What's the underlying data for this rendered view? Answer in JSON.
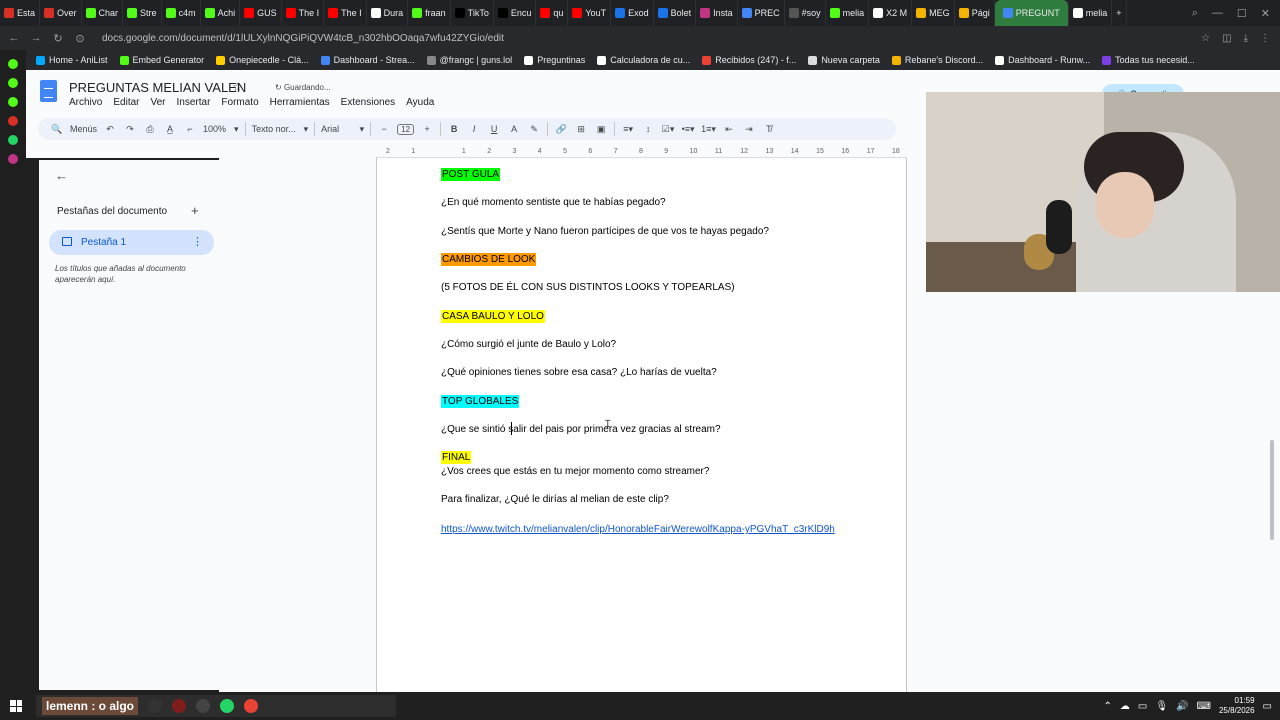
{
  "browser": {
    "tabs": [
      {
        "label": "Esta",
        "color": "#d93025"
      },
      {
        "label": "Over",
        "color": "#d93025"
      },
      {
        "label": "Char",
        "color": "#53fc18"
      },
      {
        "label": "Stre",
        "color": "#53fc18"
      },
      {
        "label": "c4m",
        "color": "#53fc18"
      },
      {
        "label": "Achi",
        "color": "#53fc18"
      },
      {
        "label": "GUS",
        "color": "#ff0000"
      },
      {
        "label": "The I",
        "color": "#ff0000"
      },
      {
        "label": "The I",
        "color": "#ff0000"
      },
      {
        "label": "Dura",
        "color": "#ffffff"
      },
      {
        "label": "fraan",
        "color": "#53fc18"
      },
      {
        "label": "TikTo",
        "color": "#000000"
      },
      {
        "label": "Encu",
        "color": "#000000"
      },
      {
        "label": "qu",
        "color": "#ff0000"
      },
      {
        "label": "YouT",
        "color": "#ff0000"
      },
      {
        "label": "Exod",
        "color": "#1a73e8"
      },
      {
        "label": "Bolet",
        "color": "#1a73e8"
      },
      {
        "label": "Insta",
        "color": "#c13584"
      },
      {
        "label": "PREC",
        "color": "#4285f4"
      },
      {
        "label": "#soy",
        "color": "#555555"
      },
      {
        "label": "melia",
        "color": "#53fc18"
      },
      {
        "label": "X2 M",
        "color": "#ffffff"
      },
      {
        "label": "MEG",
        "color": "#f4b400"
      },
      {
        "label": "Pági",
        "color": "#f4b400"
      },
      {
        "label": "PREGUNT",
        "color": "#4285f4",
        "active": true
      },
      {
        "label": "melia",
        "color": "#ffffff"
      }
    ],
    "new_tab": "+",
    "url": "docs.google.com/document/d/1lULXylnNQGiPiQVW4tcB_n302hbOOaqa7wfu42ZYGio/edit",
    "bookmarks": [
      {
        "label": "Home - AniList",
        "color": "#02a9ff"
      },
      {
        "label": "Embed Generator",
        "color": "#53fc18"
      },
      {
        "label": "Onepiecedle - Clá...",
        "color": "#ffcc00"
      },
      {
        "label": "Dashboard - Strea...",
        "color": "#4285f4"
      },
      {
        "label": "@frangc | guns.lol",
        "color": "#888888"
      },
      {
        "label": "Preguntinas",
        "color": "#ffffff"
      },
      {
        "label": "Calculadora de cu...",
        "color": "#ffffff"
      },
      {
        "label": "Recibidos (247) - f...",
        "color": "#ea4335"
      },
      {
        "label": "Nueva carpeta",
        "color": "#dadce0"
      },
      {
        "label": "Rebane's Discord...",
        "color": "#f4b400"
      },
      {
        "label": "Dashboard - Runw...",
        "color": "#ffffff"
      },
      {
        "label": "Todas tus necesid...",
        "color": "#7b3fe4"
      }
    ]
  },
  "docs": {
    "title": "PREGUNTAS MELIAN VALEN",
    "saving_status": "Guardando...",
    "menu": [
      "Archivo",
      "Editar",
      "Ver",
      "Insertar",
      "Formato",
      "Herramientas",
      "Extensiones",
      "Ayuda"
    ],
    "share_label": "Compartir",
    "toolbar": {
      "menus_label": "Menús",
      "zoom": "100%",
      "style": "Texto nor...",
      "font": "Arial",
      "font_size": "12"
    },
    "outline": {
      "title": "Pestañas del documento",
      "tab_name": "Pestaña 1",
      "hint": "Los títulos que añadas al documento aparecerán aquí."
    },
    "ruler_marks": [
      "2",
      "1",
      "",
      "1",
      "2",
      "3",
      "4",
      "5",
      "6",
      "7",
      "8",
      "9",
      "10",
      "11",
      "12",
      "13",
      "14",
      "15",
      "16",
      "17",
      "18"
    ]
  },
  "document": {
    "lines": [
      {
        "text": "POST GULA",
        "highlight": "#00ff00"
      },
      {
        "text": "¿En qué momento sentiste que te habías pegado?"
      },
      {
        "text": "¿Sentís que Morte y Nano fueron partícipes de que vos te hayas pegado?"
      },
      {
        "text": "CAMBIOS DE LOOK",
        "highlight": "#ff9900"
      },
      {
        "text": "(5 FOTOS DE ÉL CON SUS DISTINTOS LOOKS Y TOPEARLAS)"
      },
      {
        "text": "CASA BAULO Y LOLO",
        "highlight": "#ffff00"
      },
      {
        "text": "¿Cómo surgió el junte de Baulo y Lolo?"
      },
      {
        "text": "¿Qué opiniones tienes sobre esa casa? ¿Lo harías de vuelta?"
      },
      {
        "text": "TOP GLOBALES",
        "highlight": "#00ffff"
      },
      {
        "text": "¿Que se sintió salir del pais por primera vez gracias al stream?"
      },
      {
        "text": "FINAL",
        "highlight": "#ffff00"
      },
      {
        "text": "¿Vos crees que estás en tu mejor momento como streamer?"
      },
      {
        "text": "Para finalizar, ¿Qué le dirías al melian de este clip?"
      },
      {
        "text": "https://www.twitch.tv/melianvalen/clip/HonorableFairWerewolfKappa-yPGVhaT_c3rKlD9h",
        "link": true
      }
    ]
  },
  "taskbar": {
    "search_text": "lemenn : o algo",
    "time": "01:59",
    "date": "25/8/2026"
  },
  "colors": {
    "accent": "#0b57d0",
    "share": "#c2e7ff",
    "active_tab": "#2f7d3e"
  }
}
